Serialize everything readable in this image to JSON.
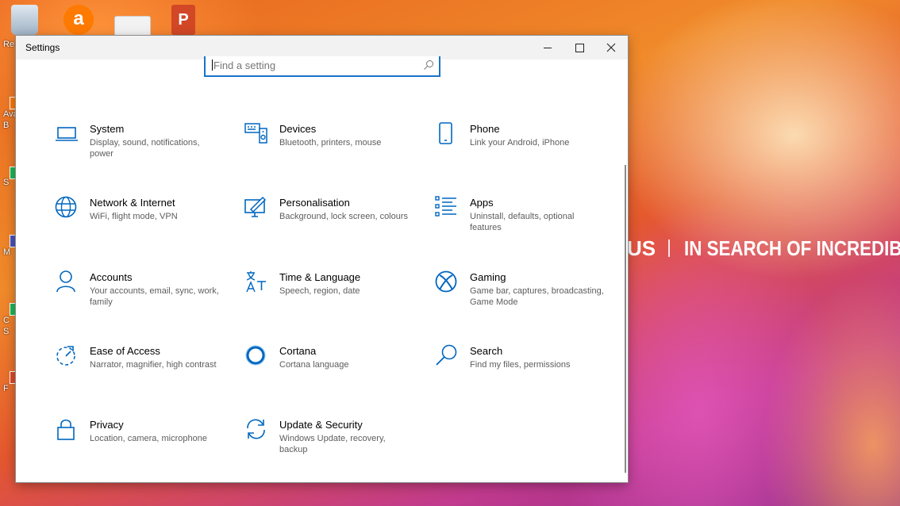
{
  "desktop": {
    "recycle_label": "Re",
    "side_labels": [
      "Ava",
      "B",
      "S",
      "M",
      "C",
      "S",
      "F"
    ],
    "brand_slogan": "IN SEARCH OF INCREDIBLE",
    "brand_partial": "US"
  },
  "window": {
    "title": "Settings",
    "search_placeholder": "Find a setting"
  },
  "tiles": [
    {
      "title": "System",
      "desc": "Display, sound, notifications, power",
      "icon": "laptop-icon"
    },
    {
      "title": "Devices",
      "desc": "Bluetooth, printers, mouse",
      "icon": "keyboard-speaker-icon"
    },
    {
      "title": "Phone",
      "desc": "Link your Android, iPhone",
      "icon": "phone-icon"
    },
    {
      "title": "Network & Internet",
      "desc": "WiFi, flight mode, VPN",
      "icon": "globe-icon"
    },
    {
      "title": "Personalisation",
      "desc": "Background, lock screen, colours",
      "icon": "paint-monitor-icon"
    },
    {
      "title": "Apps",
      "desc": "Uninstall, defaults, optional features",
      "icon": "apps-list-icon"
    },
    {
      "title": "Accounts",
      "desc": "Your accounts, email, sync, work, family",
      "icon": "person-icon"
    },
    {
      "title": "Time & Language",
      "desc": "Speech, region, date",
      "icon": "time-language-icon"
    },
    {
      "title": "Gaming",
      "desc": "Game bar, captures, broadcasting, Game Mode",
      "icon": "xbox-icon"
    },
    {
      "title": "Ease of Access",
      "desc": "Narrator, magnifier, high contrast",
      "icon": "ease-of-access-icon"
    },
    {
      "title": "Cortana",
      "desc": "Cortana language",
      "icon": "cortana-icon"
    },
    {
      "title": "Search",
      "desc": "Find my files, permissions",
      "icon": "search-icon"
    },
    {
      "title": "Privacy",
      "desc": "Location, camera, microphone",
      "icon": "lock-icon"
    },
    {
      "title": "Update & Security",
      "desc": "Windows Update, recovery, backup",
      "icon": "sync-icon"
    }
  ],
  "colors": {
    "accent": "#0067c0",
    "desc_text": "#5d5d5d"
  }
}
